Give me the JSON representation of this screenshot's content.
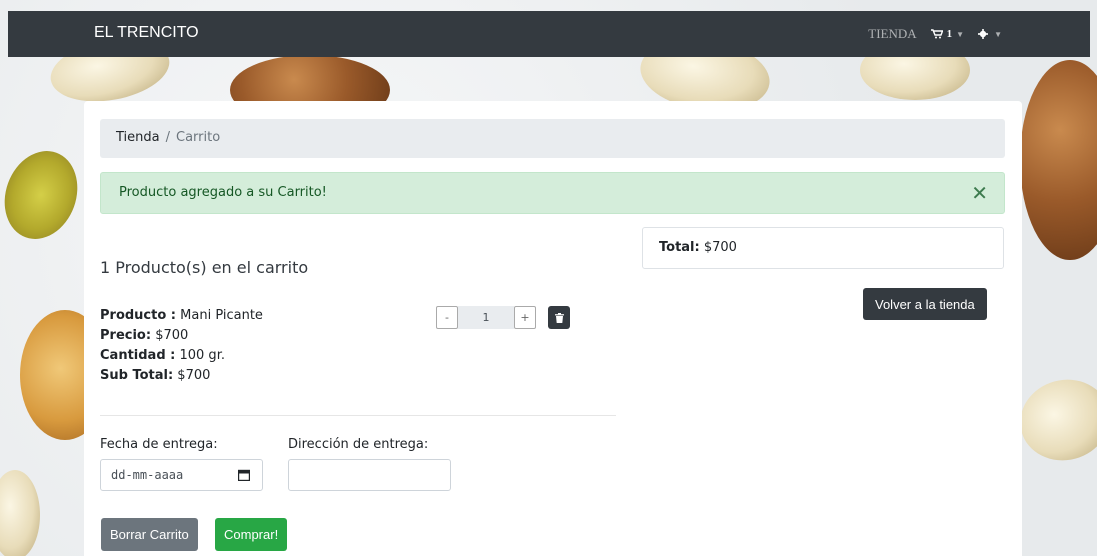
{
  "navbar": {
    "brand": "EL TRENCITO",
    "shop_link": "TIENDA",
    "cart_count": "1",
    "icons": [
      "cart-icon",
      "chevron-down-icon",
      "gear-icon",
      "chevron-down-icon"
    ]
  },
  "breadcrumb": {
    "home": "Tienda",
    "separator": "/",
    "current": "Carrito"
  },
  "alert": {
    "message": "Producto agregado a su Carrito!",
    "close": "✕"
  },
  "cart": {
    "count_text": "1 Producto(s) en el carrito",
    "item": {
      "product_label": "Producto :",
      "product_value": " Mani Picante",
      "price_label": "Precio:",
      "price_value": " $700",
      "quantity_label": "Cantidad :",
      "quantity_value": " 100 gr.",
      "subtotal_label": "Sub Total:",
      "subtotal_value": " $700",
      "qty_minus": "-",
      "qty_value": "1",
      "qty_plus": "+"
    }
  },
  "summary": {
    "total_label": "Total:",
    "total_value": " $700",
    "back_button": "Volver a la tienda"
  },
  "delivery": {
    "date_label": "Fecha de entrega:",
    "date_placeholder": "dd-mm-aaaa",
    "address_label": "Dirección de entrega:",
    "address_value": ""
  },
  "actions": {
    "clear_cart": "Borrar Carrito",
    "buy": "Comprar!"
  },
  "colors": {
    "navbar": "#343a40",
    "alert_bg": "#d4edda",
    "alert_text": "#155724",
    "buy_button": "#28a745",
    "clear_button": "#6c757d"
  }
}
